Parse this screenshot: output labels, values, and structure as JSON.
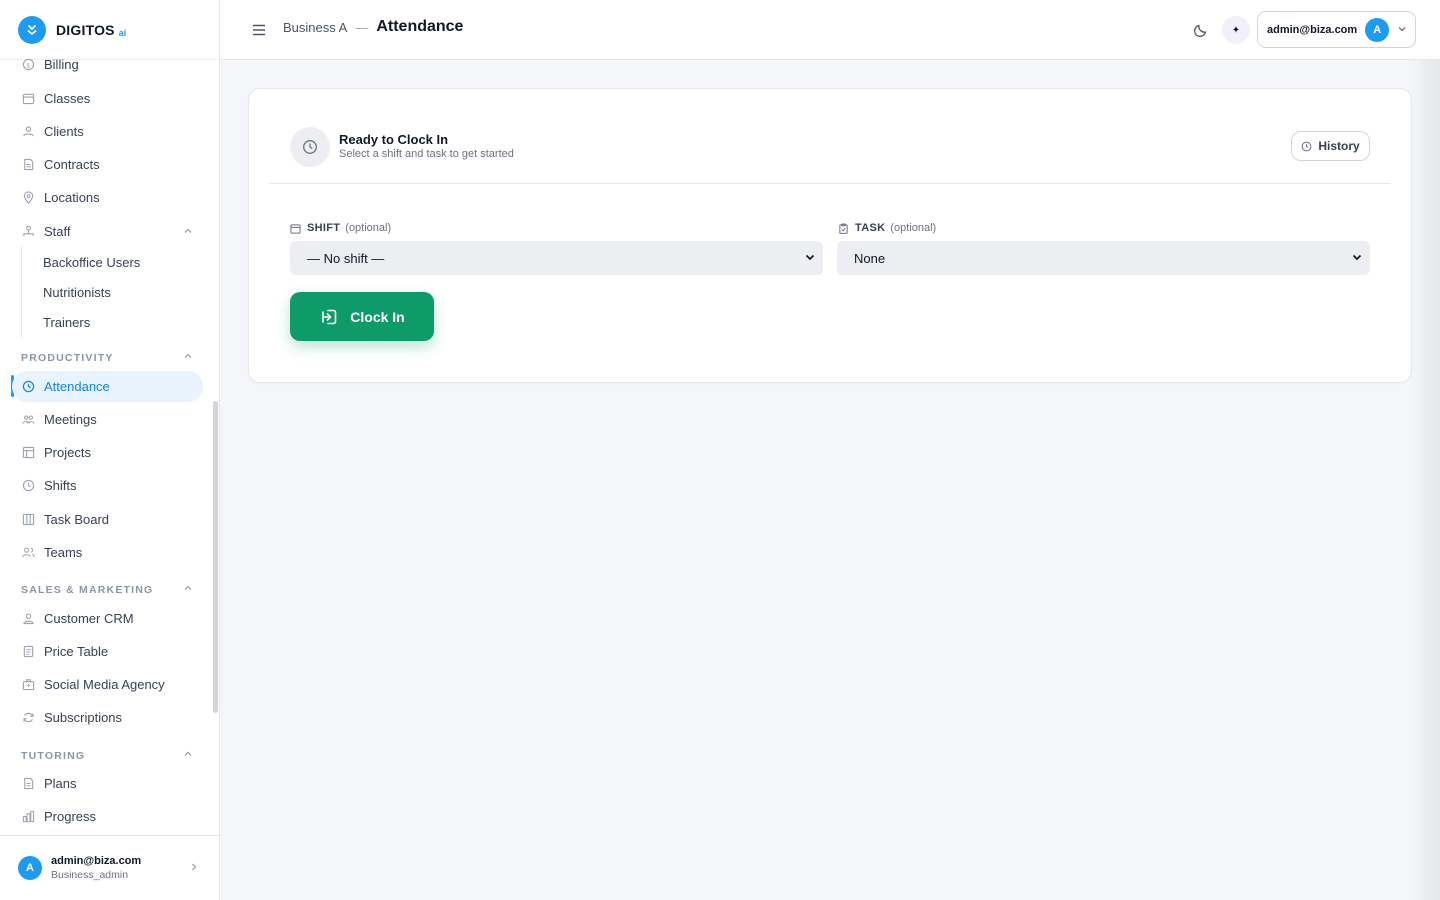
{
  "brand": {
    "name": "DIGITOS",
    "suffix": "ai"
  },
  "sidebar": {
    "items": [
      {
        "label": "Billing",
        "icon": "dollar-circle-icon"
      },
      {
        "label": "Classes",
        "icon": "calendar-icon"
      },
      {
        "label": "Clients",
        "icon": "users-icon"
      },
      {
        "label": "Contracts",
        "icon": "document-icon"
      },
      {
        "label": "Locations",
        "icon": "map-pin-icon"
      },
      {
        "label": "Staff",
        "icon": "org-chart-icon"
      }
    ],
    "staff_sub": [
      "Backoffice Users",
      "Nutritionists",
      "Trainers"
    ],
    "sections": {
      "productivity": "PRODUCTIVITY",
      "sales": "SALES & MARKETING",
      "tutoring": "TUTORING"
    },
    "productivity_items": [
      {
        "label": "Attendance",
        "icon": "clock-icon",
        "active": true
      },
      {
        "label": "Meetings",
        "icon": "people-group-icon"
      },
      {
        "label": "Projects",
        "icon": "layout-icon"
      },
      {
        "label": "Shifts",
        "icon": "clock-icon"
      },
      {
        "label": "Task Board",
        "icon": "columns-icon"
      },
      {
        "label": "Teams",
        "icon": "team-icon"
      }
    ],
    "sales_items": [
      {
        "label": "Customer CRM",
        "icon": "contact-icon"
      },
      {
        "label": "Price Table",
        "icon": "receipt-icon"
      },
      {
        "label": "Social Media Agency",
        "icon": "briefcase-icon"
      },
      {
        "label": "Subscriptions",
        "icon": "refresh-icon"
      }
    ],
    "tutoring_items": [
      {
        "label": "Plans",
        "icon": "document-icon"
      },
      {
        "label": "Progress",
        "icon": "bar-chart-icon"
      }
    ],
    "footer": {
      "avatar": "A",
      "email": "admin@biza.com",
      "role": "Business_admin"
    }
  },
  "header": {
    "breadcrumb_parent": "Business A",
    "breadcrumb_sep": "—",
    "title": "Attendance",
    "sparkle": "✦",
    "user_email": "admin@biza.com",
    "user_avatar": "A"
  },
  "main": {
    "status_title": "Ready to Clock In",
    "status_subtitle": "Select a shift and task to get started",
    "history_label": "History",
    "shift_label": "SHIFT",
    "shift_optional": "(optional)",
    "shift_value": "— No shift —",
    "task_label": "TASK",
    "task_optional": "(optional)",
    "task_value": "None",
    "clock_in_label": "Clock In"
  },
  "colors": {
    "accent": "#1e9bf0",
    "clock_in": "#0f9a6a",
    "active_bg": "#e8f3fd"
  }
}
